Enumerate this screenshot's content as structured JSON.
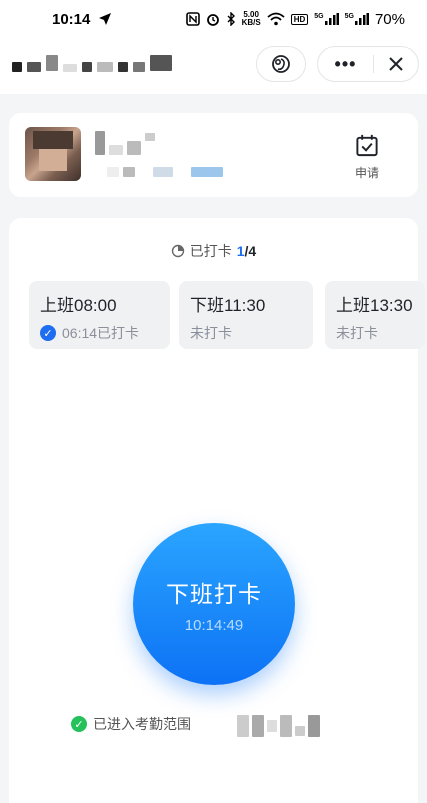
{
  "status_bar": {
    "time": "10:14",
    "net_speed_value": "5.00",
    "net_speed_unit": "KB/S",
    "hd_label": "HD",
    "sig1_label": "5G",
    "sig2_label": "5G",
    "battery": "70%"
  },
  "progress": {
    "label": "已打卡",
    "current": "1",
    "total": "/4"
  },
  "punch_slots": [
    {
      "time": "上班08:00",
      "status": "06:14已打卡",
      "done": true
    },
    {
      "time": "下班11:30",
      "status": "未打卡",
      "done": false
    },
    {
      "time": "上班13:30",
      "status": "未打卡",
      "done": false
    }
  ],
  "profile": {
    "apply_label": "申请"
  },
  "punch_button": {
    "label": "下班打卡",
    "time": "10:14:49"
  },
  "range_status": "已进入考勤范围",
  "colors": {
    "accent": "#1d6ef0",
    "punch_gradient_top": "#2aa5ff",
    "punch_gradient_bottom": "#0d72f5",
    "success": "#25c15a"
  },
  "icons": {
    "status_bar": [
      "location-arrow-icon",
      "nfc-icon",
      "alarm-icon",
      "bluetooth-icon",
      "wifi-icon",
      "signal-icon"
    ],
    "header": [
      "mini-program-icon",
      "more-icon",
      "close-icon"
    ],
    "profile": [
      "calendar-check-icon"
    ],
    "progress": [
      "pie-progress-icon"
    ]
  }
}
